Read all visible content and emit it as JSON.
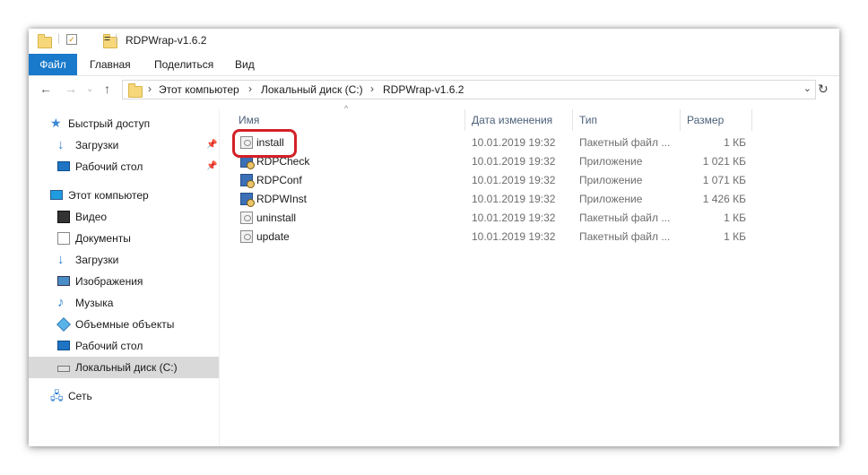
{
  "window": {
    "title": "RDPWrap-v1.6.2"
  },
  "quick_access_toolbar": {
    "dropdown_symbol": "="
  },
  "ribbon": {
    "tabs": [
      "Файл",
      "Главная",
      "Поделиться",
      "Вид"
    ]
  },
  "address_bar": {
    "segments": [
      "Этот компьютер",
      "Локальный диск (C:)",
      "RDPWrap-v1.6.2"
    ]
  },
  "nav_pane": {
    "quick_access": {
      "label": "Быстрый доступ",
      "icon": "star-icon"
    },
    "pinned": [
      {
        "label": "Загрузки",
        "icon": "download-arrow-icon",
        "pinned": true
      },
      {
        "label": "Рабочий стол",
        "icon": "desktop-icon",
        "pinned": true
      }
    ],
    "this_pc": {
      "label": "Этот компьютер",
      "icon": "computer-icon"
    },
    "pc_items": [
      {
        "label": "Видео",
        "icon": "video-icon"
      },
      {
        "label": "Документы",
        "icon": "document-icon"
      },
      {
        "label": "Загрузки",
        "icon": "download-arrow-icon"
      },
      {
        "label": "Изображения",
        "icon": "pictures-icon"
      },
      {
        "label": "Музыка",
        "icon": "music-icon"
      },
      {
        "label": "Объемные объекты",
        "icon": "3d-objects-icon"
      },
      {
        "label": "Рабочий стол",
        "icon": "desktop-icon"
      },
      {
        "label": "Локальный диск (C:)",
        "icon": "drive-icon",
        "selected": true
      }
    ],
    "network": {
      "label": "Сеть",
      "icon": "network-icon"
    }
  },
  "file_list": {
    "columns": {
      "name": "Имя",
      "modified": "Дата изменения",
      "type": "Тип",
      "size": "Размер"
    },
    "rows": [
      {
        "name": "install",
        "modified": "10.01.2019 19:32",
        "type": "Пакетный файл ...",
        "size": "1 КБ",
        "icon": "batch-file-icon",
        "highlighted": true
      },
      {
        "name": "RDPCheck",
        "modified": "10.01.2019 19:32",
        "type": "Приложение",
        "size": "1 021 КБ",
        "icon": "application-icon"
      },
      {
        "name": "RDPConf",
        "modified": "10.01.2019 19:32",
        "type": "Приложение",
        "size": "1 071 КБ",
        "icon": "application-icon"
      },
      {
        "name": "RDPWInst",
        "modified": "10.01.2019 19:32",
        "type": "Приложение",
        "size": "1 426 КБ",
        "icon": "application-icon"
      },
      {
        "name": "uninstall",
        "modified": "10.01.2019 19:32",
        "type": "Пакетный файл ...",
        "size": "1 КБ",
        "icon": "batch-file-icon"
      },
      {
        "name": "update",
        "modified": "10.01.2019 19:32",
        "type": "Пакетный файл ...",
        "size": "1 КБ",
        "icon": "batch-file-icon"
      }
    ]
  },
  "colors": {
    "file_tab": "#1979ca",
    "highlight_border": "#d32027",
    "selected_nav": "#d9d9d9"
  }
}
